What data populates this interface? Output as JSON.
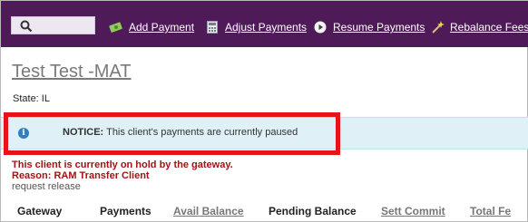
{
  "search": {
    "placeholder": ""
  },
  "nav": [
    {
      "label": "Add Payment",
      "icon": "money-icon"
    },
    {
      "label": "Adjust Payments",
      "icon": "calculator-icon"
    },
    {
      "label": "Resume Payments",
      "icon": "play-icon"
    },
    {
      "label": "Rebalance Fees",
      "icon": "magic-wand-icon"
    }
  ],
  "client": {
    "name": "Test Test -MAT",
    "state": "State: IL"
  },
  "notice": {
    "label": "NOTICE:",
    "message": "This client's payments are currently paused"
  },
  "hold": {
    "line1": "This client is currently on hold by the gateway.",
    "line2": "Reason: RAM Transfer Client",
    "release": "request release"
  },
  "table": {
    "headers": [
      "Gateway",
      "Payments",
      "Avail Balance",
      "Pending Balance",
      "Sett Commit",
      "Total Fe"
    ]
  },
  "colors": {
    "topbar": "#4e1a57",
    "notice_bg": "#dff0f7",
    "highlight": "#e8121b",
    "hold_text": "#a01414"
  }
}
